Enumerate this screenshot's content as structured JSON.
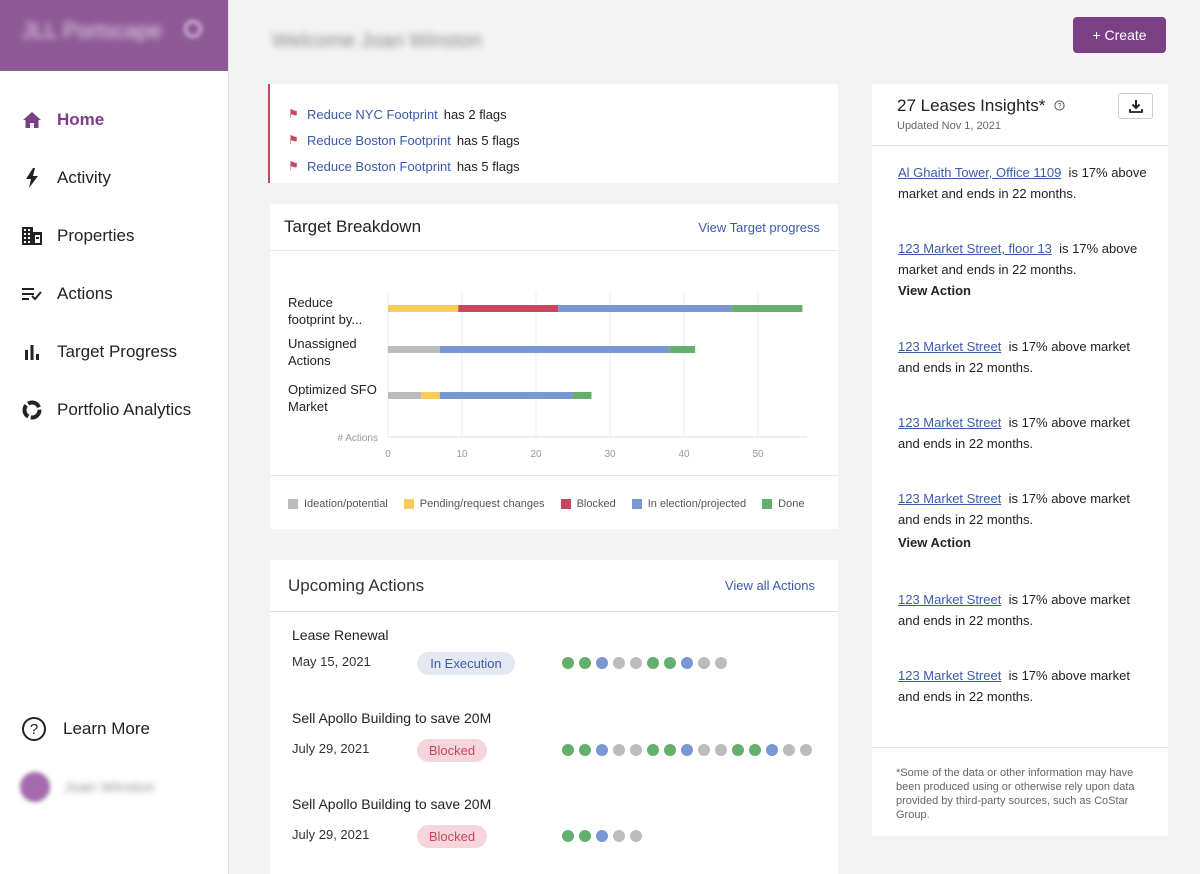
{
  "brand": {
    "name": "JLL Portscape"
  },
  "welcome": "Welcome Joan Winston",
  "create_label": "+ Create",
  "nav": [
    {
      "label": "Home",
      "icon": "home-icon"
    },
    {
      "label": "Activity",
      "icon": "bolt-icon"
    },
    {
      "label": "Properties",
      "icon": "building-icon"
    },
    {
      "label": "Actions",
      "icon": "checklist-icon"
    },
    {
      "label": "Target Progress",
      "icon": "bar-chart-icon"
    },
    {
      "label": "Portfolio Analytics",
      "icon": "donut-icon"
    }
  ],
  "learn_more": "Learn More",
  "user_name": "Joan Winston",
  "flags": [
    {
      "link": "Reduce NYC Footprint",
      "text": "has 2 flags"
    },
    {
      "link": "Reduce Boston Footprint",
      "text": "has 5 flags"
    },
    {
      "link": "Reduce Boston Footprint",
      "text": "has 5 flags"
    }
  ],
  "target": {
    "title": "Target Breakdown",
    "link": "View Target progress",
    "axis_label": "# Actions",
    "ticks": [
      0,
      10,
      20,
      30,
      40,
      50
    ],
    "rows": [
      {
        "line1": "Reduce",
        "line2": "footprint by...",
        "segments": [
          [
            0,
            9.5
          ],
          [
            9.5,
            23
          ],
          [
            23,
            46.5
          ],
          [
            46.5,
            56
          ]
        ],
        "colors": [
          "#f5cd5b",
          "#c8475d",
          "#7897d3",
          "#64ae6e"
        ]
      },
      {
        "line1": "Unassigned",
        "line2": "Actions",
        "segments": [
          [
            0,
            7
          ],
          [
            7,
            38
          ],
          [
            38,
            41.5
          ]
        ],
        "colors": [
          "#bcbcbc",
          "#7897d3",
          "#64ae6e"
        ]
      },
      {
        "line1": "Optimized SFO",
        "line2": "Market",
        "segments": [
          [
            0,
            4.5
          ],
          [
            4.5,
            7
          ],
          [
            7,
            25
          ],
          [
            25,
            27.5
          ]
        ],
        "colors": [
          "#bcbcbc",
          "#f5cd5b",
          "#7897d3",
          "#64ae6e"
        ]
      }
    ],
    "legend": [
      {
        "label": "Ideation/potential",
        "color": "#bcbcbc"
      },
      {
        "label": "Pending/request changes",
        "color": "#f5cd5b"
      },
      {
        "label": "Blocked",
        "color": "#c8475d"
      },
      {
        "label": "In election/projected",
        "color": "#7897d3"
      },
      {
        "label": "Done",
        "color": "#64ae6e"
      }
    ]
  },
  "upcoming": {
    "title": "Upcoming Actions",
    "link": "View all Actions",
    "actions": [
      {
        "title": "Lease Renewal",
        "date": "May 15, 2021",
        "status": "In Execution"
      },
      {
        "title": "Sell Apollo Building to save 20M",
        "date": "July 29, 2021",
        "status": "Blocked"
      },
      {
        "title": "Sell Apollo Building to save 20M",
        "date": "July 29, 2021",
        "status": "Blocked"
      }
    ]
  },
  "insights": {
    "title": "27 Leases Insights*",
    "updated": "Updated Nov 1, 2021",
    "view_action": "View Action",
    "leases": [
      {
        "link": "Al Ghaith Tower, Office 1109",
        "text": "17% above market and ends in 22 months."
      },
      {
        "link": "123 Market Street, floor 13",
        "text": "is 17% above market and ends in 22 months."
      },
      {
        "link": "123 Market Street",
        "text": "is 17% above market and ends in 22 months."
      },
      {
        "link": "123 Market Street",
        "text": "is 17% above market and ends in 22 months."
      },
      {
        "link": "123 Market Street",
        "text": "is 17% above market and ends in 22 months."
      },
      {
        "link": "123 Market Street",
        "text": "is 17% above market and ends in 22 months."
      },
      {
        "link": "123 Market Street",
        "text": "is 17% above market and ends in 22 months."
      }
    ],
    "footnote": "*Some of the data or other information may have been produced using or otherwise rely upon data provided by third-party sources, such as CoStar Group."
  }
}
